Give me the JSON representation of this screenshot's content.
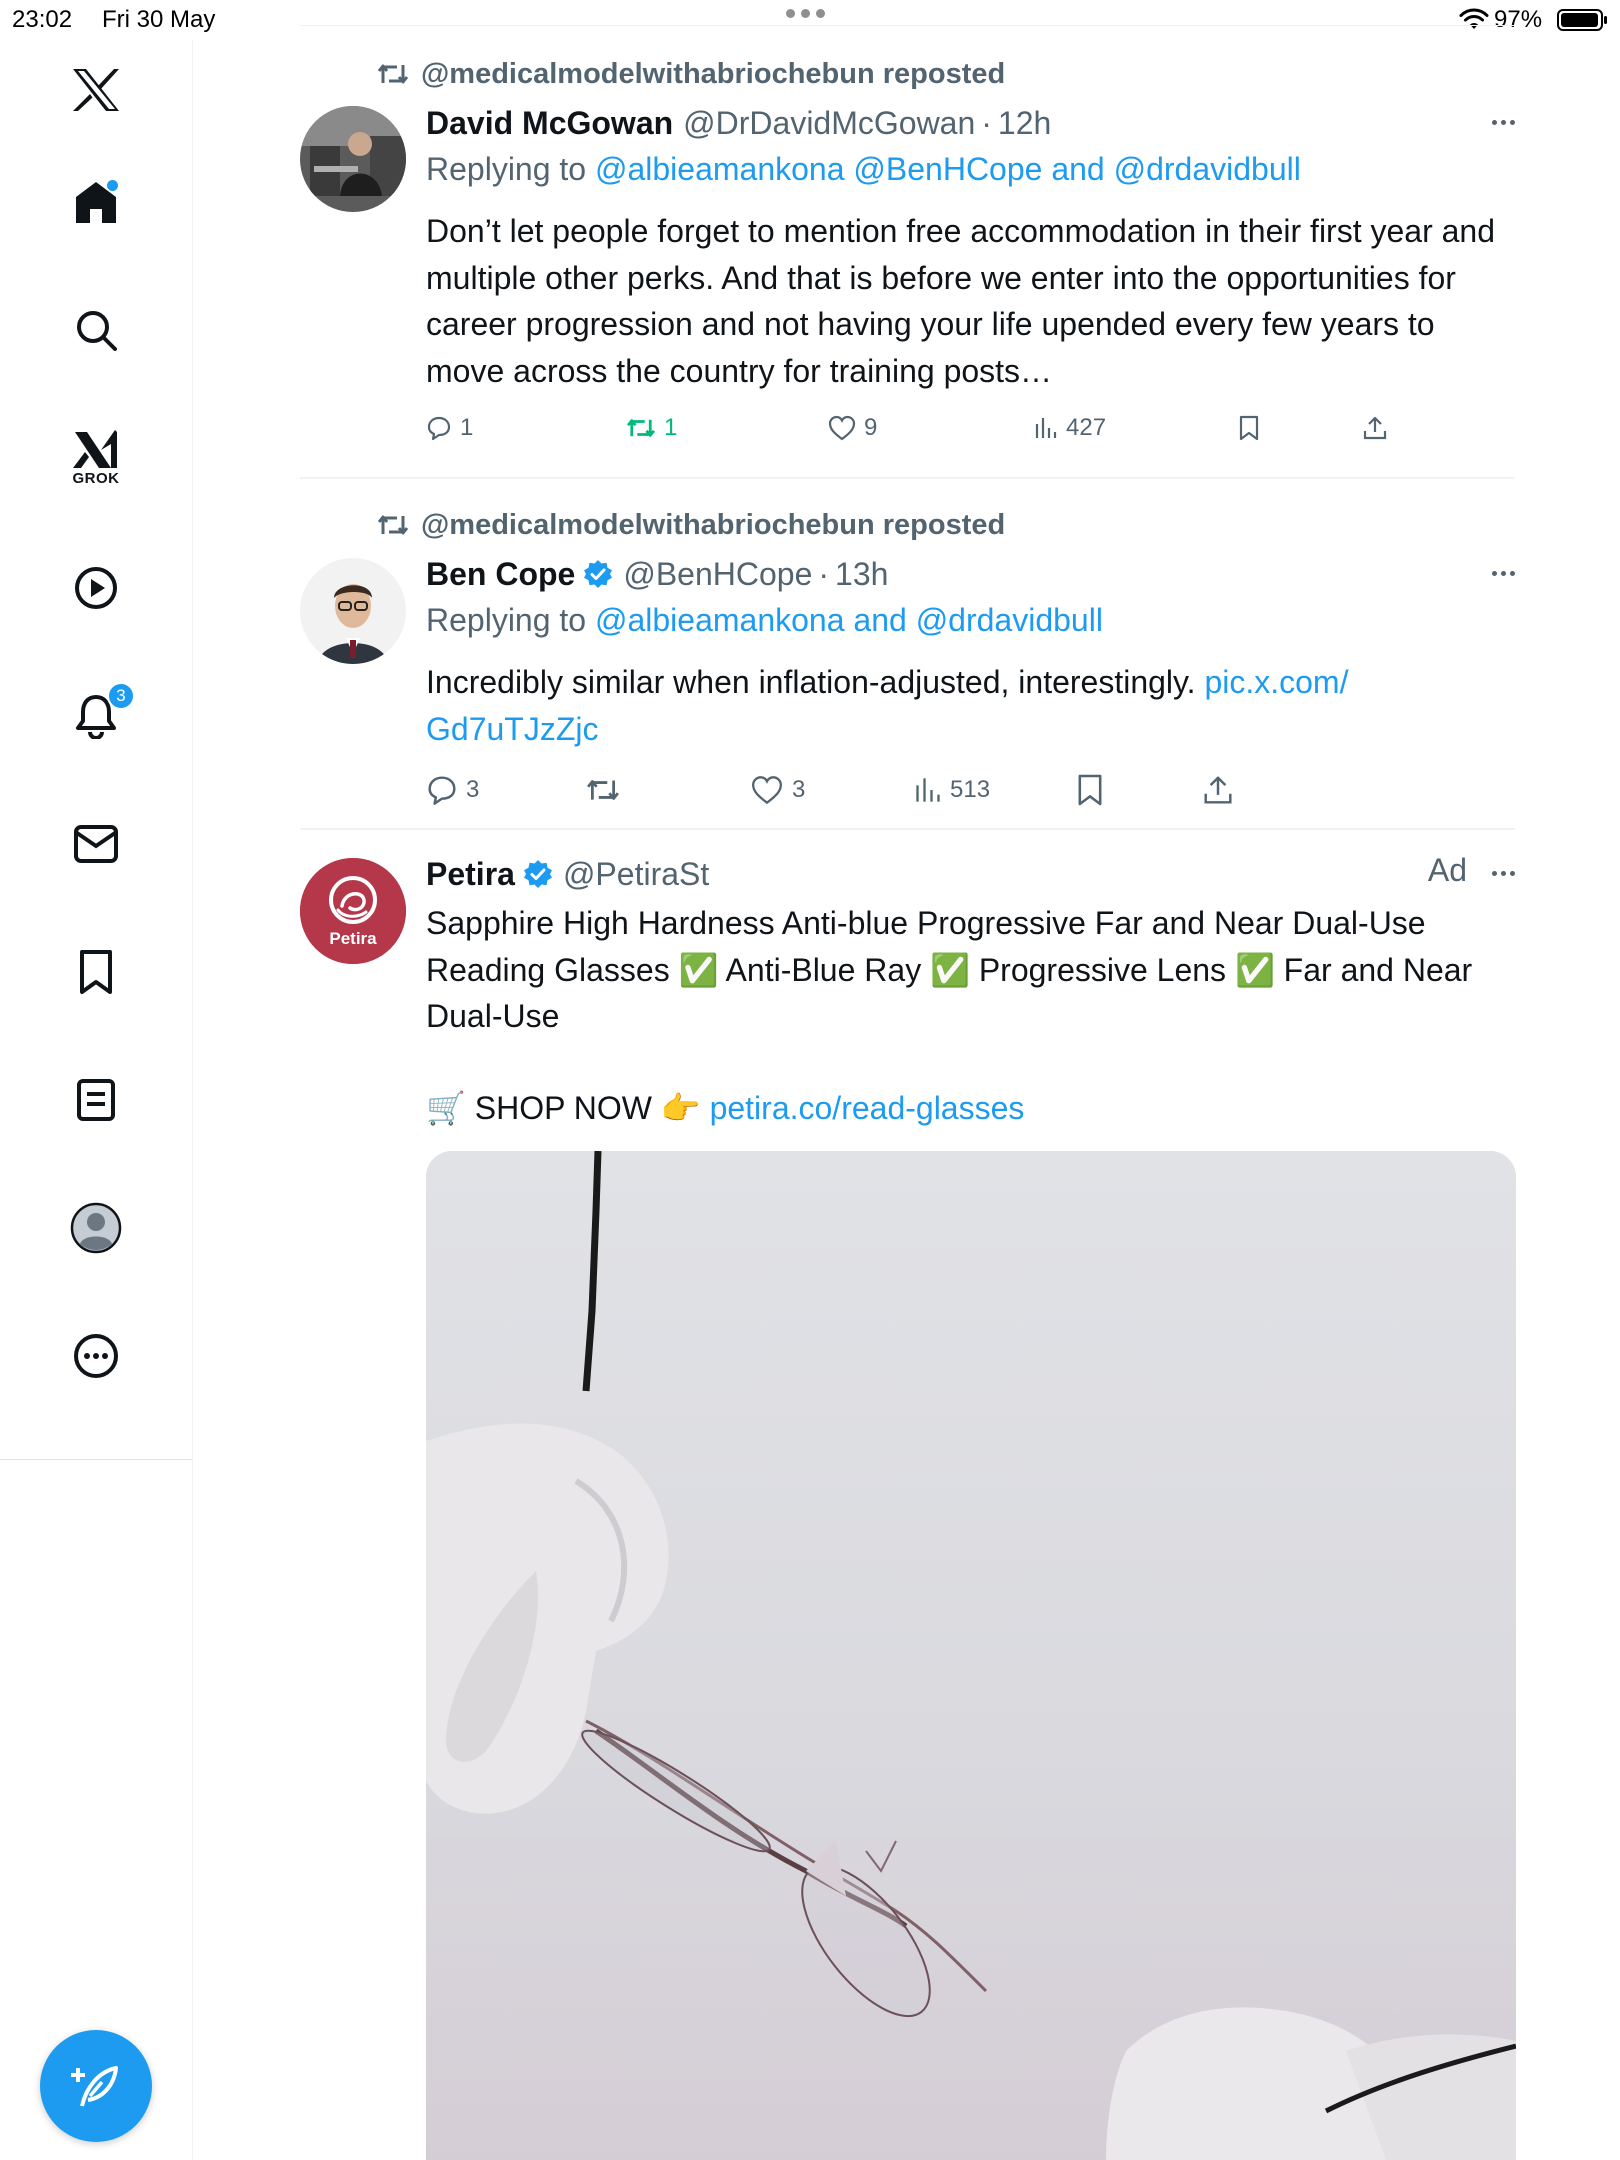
{
  "status_bar": {
    "time": "23:02",
    "date": "Fri 30 May",
    "battery": "97%"
  },
  "sidebar": {
    "items": [
      {
        "icon": "x-logo-icon"
      },
      {
        "icon": "home-icon"
      },
      {
        "icon": "search-icon"
      },
      {
        "icon": "grok-icon",
        "label": "GROK"
      },
      {
        "icon": "video-play-icon"
      },
      {
        "icon": "bell-icon",
        "badge": "3"
      },
      {
        "icon": "mail-icon"
      },
      {
        "icon": "bookmark-icon"
      },
      {
        "icon": "list-icon"
      },
      {
        "icon": "profile-avatar-icon"
      },
      {
        "icon": "more-circle-icon"
      }
    ],
    "compose_icon": "compose-feather-icon"
  },
  "colors": {
    "accent": "#1d9bf0",
    "text": "#0f1419",
    "secondary": "#536471",
    "repost_green": "#00ba7c",
    "petira_brand": "#b5384a"
  },
  "posts": [
    {
      "repost_by": "@medicalmodelwithabriochebun reposted",
      "display_name": "David McGowan",
      "handle": "@DrDavidMcGowan",
      "time": "12h",
      "replying_prefix": "Replying to",
      "replying_links": "@albieamankona @BenHCope and @drdavidbull",
      "text": "Don’t let people forget to mention free accommodation in their first year and multiple other perks. And that is before we enter into the opportunities for career progression and not having your life upended every few years to move across the country for training posts…",
      "replies": "1",
      "reposts": "1",
      "likes": "9",
      "views": "427"
    },
    {
      "repost_by": "@medicalmodelwithabriochebun reposted",
      "display_name": "Ben Cope",
      "handle": "@BenHCope",
      "time": "13h",
      "verified": true,
      "replying_prefix": "Replying to",
      "replying_links": "@albieamankona and @drdavidbull",
      "text": "Incredibly similar when inflation-adjusted, interestingly.",
      "link_text_1": "pic.x.com/",
      "link_text_2": "Gd7uTJzZjc",
      "replies": "3",
      "reposts": "",
      "likes": "3",
      "views": "513"
    },
    {
      "display_name": "Petira",
      "handle": "@PetiraSt",
      "verified": true,
      "ad_label": "Ad",
      "avatar_text": "Petira",
      "text": "Sapphire High Hardness Anti-blue Progressive Far and Near Dual-Use Reading Glasses ✅ Anti-Blue Ray ✅ Progressive Lens ✅ Far and Near Dual-Use",
      "cta_text": "🛒 SHOP NOW 👉",
      "cta_link": "petira.co/read-glasses"
    }
  ]
}
